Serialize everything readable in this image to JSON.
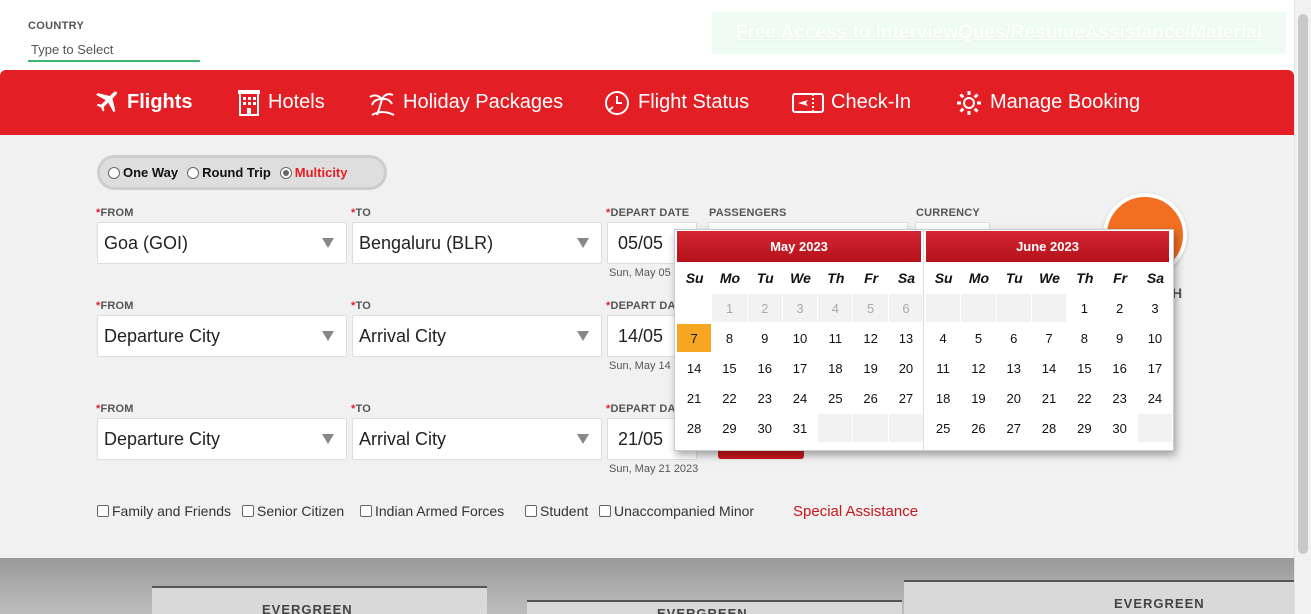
{
  "country": {
    "label": "COUNTRY",
    "placeholder": "Type to Select"
  },
  "promo": {
    "text": "Free Access to InterviewQues/ResumeAssistance/Material"
  },
  "nav": {
    "flights": "Flights",
    "hotels": "Hotels",
    "holiday": "Holiday Packages",
    "status": "Flight Status",
    "checkin": "Check-In",
    "manage": "Manage Booking"
  },
  "trip": {
    "one_way": "One Way",
    "round_trip": "Round Trip",
    "multicity": "Multicity",
    "selected": "Multicity"
  },
  "labels": {
    "from": "FROM",
    "to": "TO",
    "depart_date": "DEPART DATE",
    "depart_date_cut": "DEPART DA",
    "passengers": "PASSENGERS",
    "currency": "CURRENCY",
    "req": "*"
  },
  "legs": [
    {
      "from": "Goa (GOI)",
      "to": "Bengaluru (BLR)",
      "date": "05/05",
      "date_sub": "Sun, May 05"
    },
    {
      "from": "Departure City",
      "to": "Arrival City",
      "date": "14/05",
      "date_sub": "Sun, May 14"
    },
    {
      "from": "Departure City",
      "to": "Arrival City",
      "date": "21/05",
      "date_sub": "Sun, May 21 2023"
    }
  ],
  "search_partial": "H",
  "options": {
    "family": "Family and Friends",
    "senior": "Senior Citizen",
    "armed": "Indian Armed Forces",
    "student": "Student",
    "minor": "Unaccompanied Minor",
    "special": "Special Assistance"
  },
  "calendar": {
    "dow": [
      "Su",
      "Mo",
      "Tu",
      "We",
      "Th",
      "Fr",
      "Sa"
    ],
    "months": [
      {
        "title": "May 2023",
        "lead_blanks": 1,
        "days": [
          "1",
          "2",
          "3",
          "4",
          "5",
          "6",
          "7",
          "8",
          "9",
          "10",
          "11",
          "12",
          "13",
          "14",
          "15",
          "16",
          "17",
          "18",
          "19",
          "20",
          "21",
          "22",
          "23",
          "24",
          "25",
          "26",
          "27",
          "28",
          "29",
          "30",
          "31"
        ],
        "disabled_through": 6,
        "selected": 7
      },
      {
        "title": "June 2023",
        "lead_blanks": 4,
        "days": [
          "1",
          "2",
          "3",
          "4",
          "5",
          "6",
          "7",
          "8",
          "9",
          "10",
          "11",
          "12",
          "13",
          "14",
          "15",
          "16",
          "17",
          "18",
          "19",
          "20",
          "21",
          "22",
          "23",
          "24",
          "25",
          "26",
          "27",
          "28",
          "29",
          "30"
        ],
        "disabled_through": 0,
        "selected": 0
      }
    ]
  },
  "bottom_signs": [
    "EVERGREEN",
    "EVERGREEN",
    "EVERGREEN"
  ],
  "colors": {
    "brand_red": "#e31e24",
    "accent_orange": "#f26f21",
    "selected_day": "#f5a623",
    "underline_green": "#3cb371"
  }
}
